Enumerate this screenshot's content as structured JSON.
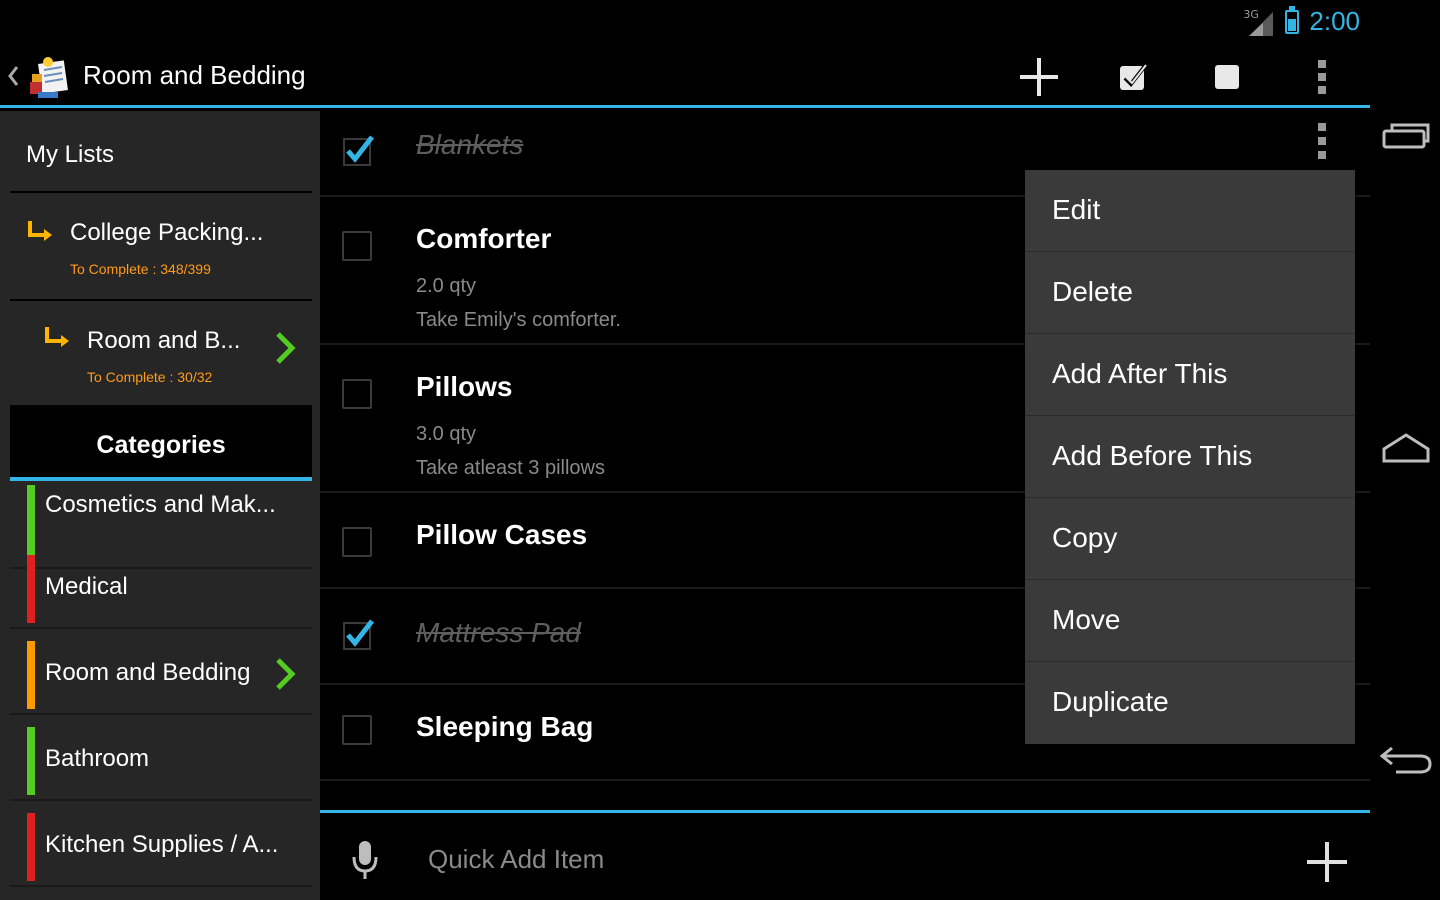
{
  "status": {
    "network": "3G",
    "time": "2:00"
  },
  "actionbar": {
    "title": "Room and Bedding",
    "icons": [
      "back-chevron-icon",
      "app-logo-icon",
      "add-icon",
      "check-all-icon",
      "uncheck-all-icon",
      "overflow-menu-icon"
    ]
  },
  "sidebar": {
    "header": "My Lists",
    "lists": [
      {
        "name": "College Packing...",
        "sub": "To Complete : 348/399"
      },
      {
        "name": "Room and B...",
        "sub": "To Complete : 30/32"
      }
    ],
    "categories_header": "Categories",
    "categories": [
      {
        "label": "Cosmetics and Mak...",
        "color": "#55cc22"
      },
      {
        "label": "Medical",
        "color": "#e02020"
      },
      {
        "label": "Room and Bedding",
        "color": "#ff9a00"
      },
      {
        "label": "Bathroom",
        "color": "#55cc22"
      },
      {
        "label": "Kitchen Supplies / A...",
        "color": "#e02020"
      }
    ]
  },
  "items": [
    {
      "name": "Blankets",
      "checked": true
    },
    {
      "name": "Comforter",
      "qty": "2.0 qty",
      "note": "Take Emily's comforter.",
      "checked": false
    },
    {
      "name": "Pillows",
      "qty": "3.0 qty",
      "note": "Take atleast 3 pillows",
      "checked": false
    },
    {
      "name": "Pillow Cases",
      "checked": false
    },
    {
      "name": "Mattress Pad",
      "checked": true
    },
    {
      "name": "Sleeping Bag",
      "checked": false
    }
  ],
  "popup_menu": [
    "Edit",
    "Delete",
    "Add After This",
    "Add Before This",
    "Copy",
    "Move",
    "Duplicate"
  ],
  "bottom": {
    "placeholder": "Quick Add Item"
  },
  "colors": {
    "accent": "#33b5e5",
    "orange": "#ff9a1a",
    "green_chevron": "#55cc22"
  }
}
